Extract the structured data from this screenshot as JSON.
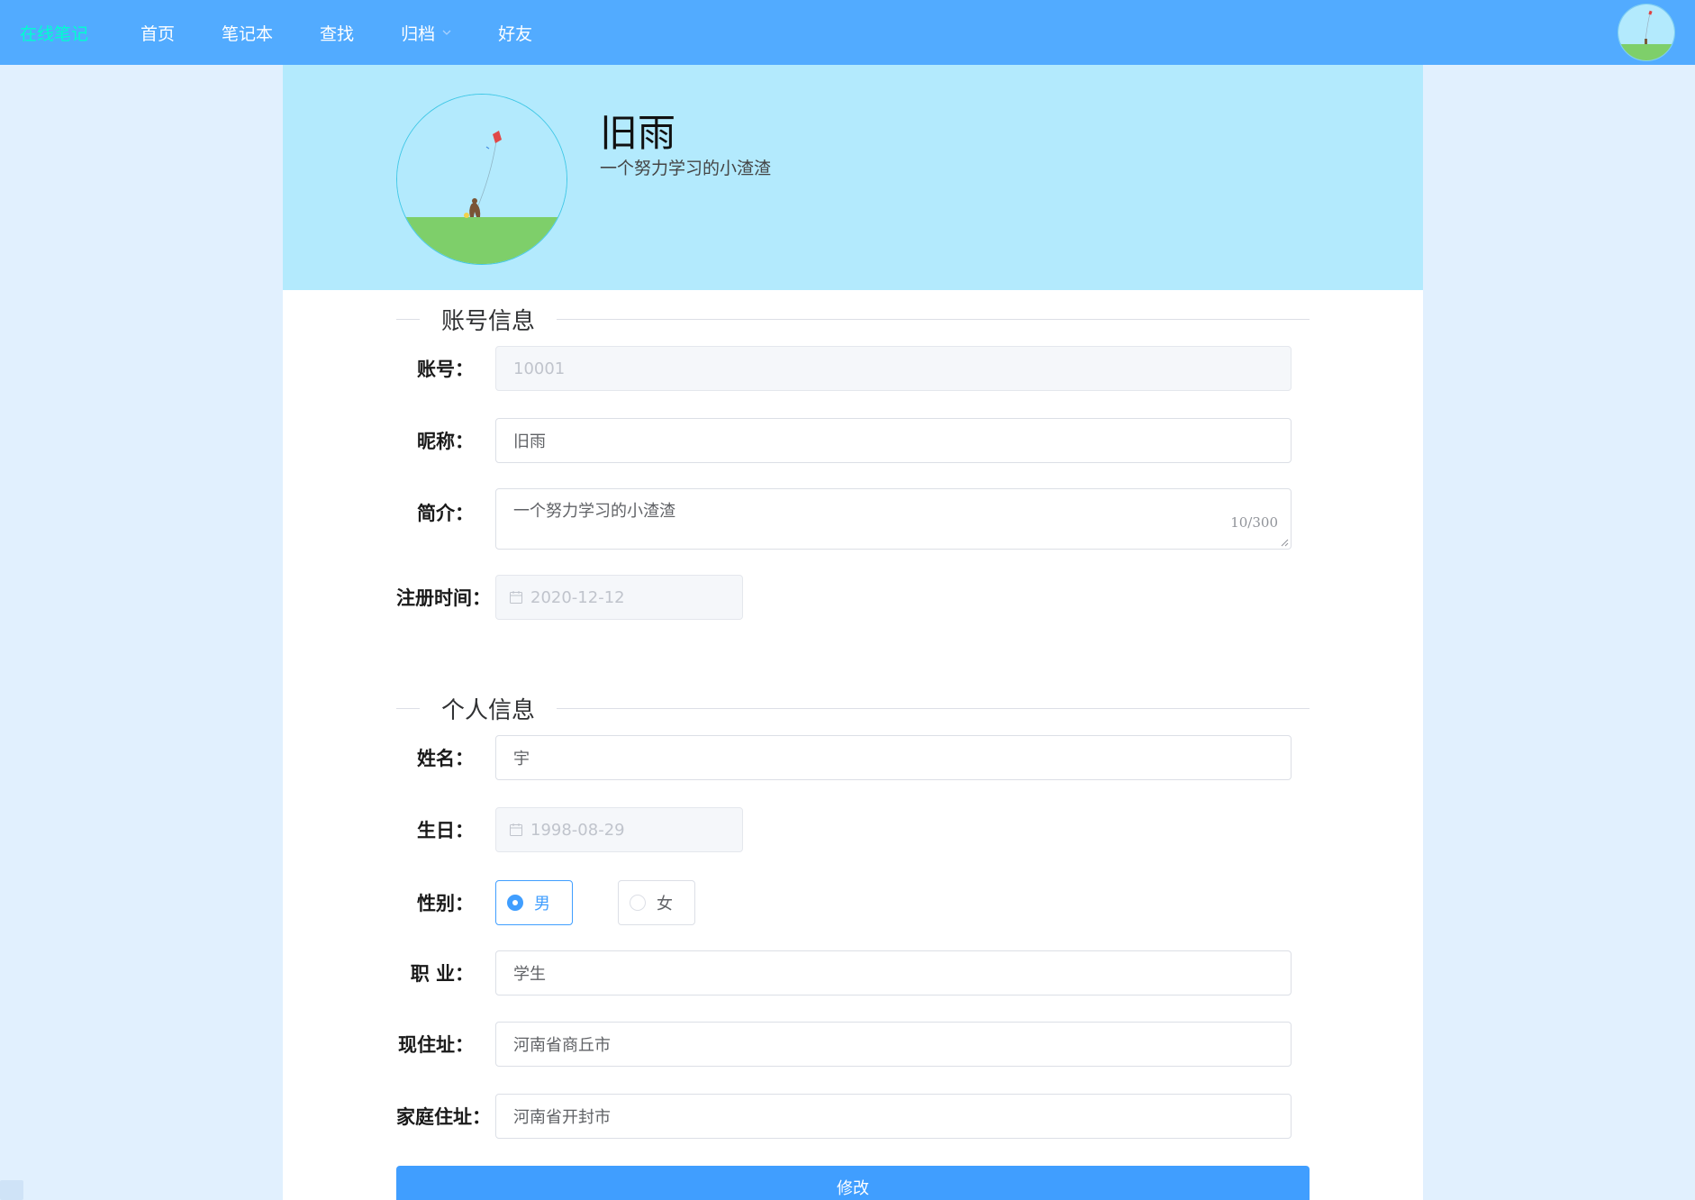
{
  "navbar": {
    "brand": "在线笔记",
    "items": [
      {
        "label": "首页"
      },
      {
        "label": "笔记本"
      },
      {
        "label": "查找"
      },
      {
        "label": "归档",
        "dropdown": true
      },
      {
        "label": "好友"
      }
    ]
  },
  "profile": {
    "name": "旧雨",
    "bio": "一个努力学习的小渣渣"
  },
  "sections": {
    "account": "账号信息",
    "personal": "个人信息"
  },
  "form": {
    "account": {
      "label": "账号：",
      "value": "10001"
    },
    "nickname": {
      "label": "昵称：",
      "value": "旧雨"
    },
    "intro": {
      "label": "简介：",
      "value": "一个努力学习的小渣渣",
      "count": "10/300"
    },
    "register_time": {
      "label": "注册时间：",
      "value": "2020-12-12"
    },
    "real_name": {
      "label": "姓名：",
      "value": "宇"
    },
    "birthday": {
      "label": "生日：",
      "value": "1998-08-29"
    },
    "gender": {
      "label": "性别：",
      "options": [
        "男",
        "女"
      ],
      "selected": "男"
    },
    "job": {
      "label": "职 业：",
      "value": "学生"
    },
    "current_address": {
      "label": "现住址：",
      "value": "河南省商丘市"
    },
    "home_address": {
      "label": "家庭住址：",
      "value": "河南省开封市"
    }
  },
  "submit_label": "修改",
  "colors": {
    "navbar": "#52abff",
    "brand": "#00ffd0",
    "header": "#b3eafd",
    "page_bg": "#e1f0fe",
    "primary": "#409eff"
  }
}
